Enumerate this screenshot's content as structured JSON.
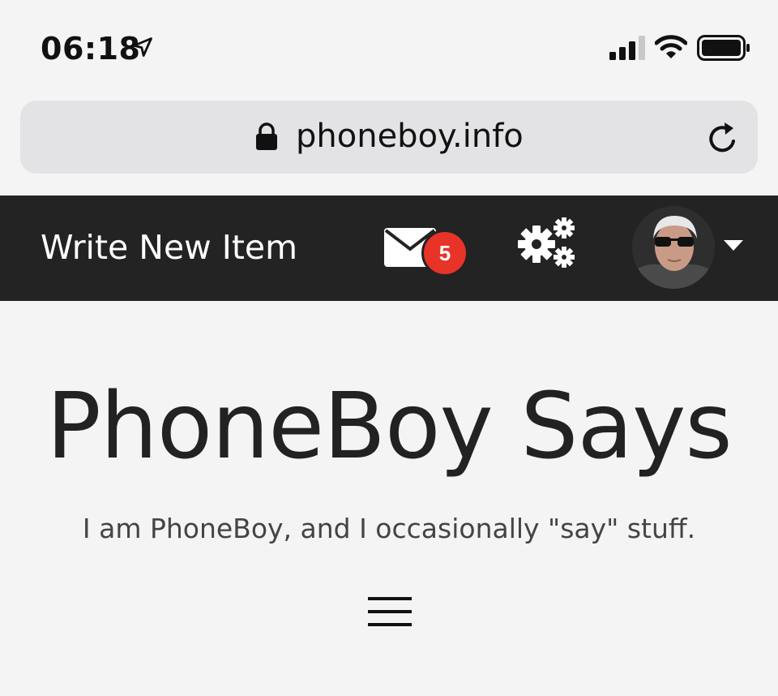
{
  "status_bar": {
    "time": "06:18",
    "icons": [
      "location-arrow-icon",
      "cell-signal-icon",
      "wifi-icon",
      "battery-icon"
    ]
  },
  "browser": {
    "url": "phoneboy.info",
    "icons": [
      "lock-icon",
      "reload-icon"
    ]
  },
  "top_nav": {
    "write_new_label": "Write New Item",
    "mail_badge_count": "5",
    "icons": [
      "mail-icon",
      "gears-icon",
      "avatar",
      "caret-down-icon"
    ]
  },
  "site": {
    "title": "PhoneBoy Says",
    "tagline": "I am PhoneBoy, and I occasionally \"say\" stuff."
  },
  "colors": {
    "page_bg": "#f4f4f4",
    "nav_bg": "#232323",
    "badge": "#e83328",
    "url_bar_bg": "#e3e3e5"
  }
}
